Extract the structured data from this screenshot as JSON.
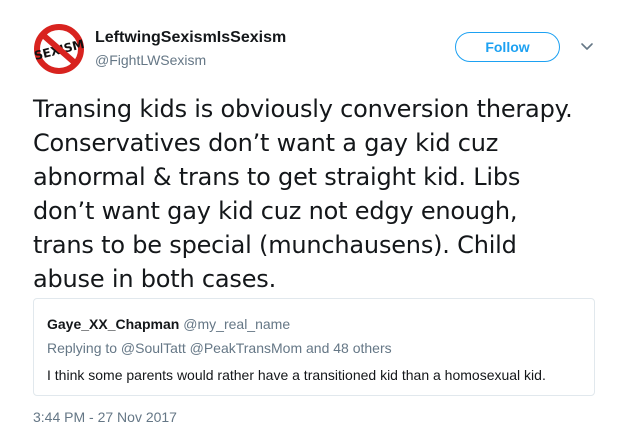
{
  "author": {
    "display_name": "LeftwingSexismIsSexism",
    "handle": "@FightLWSexism",
    "avatar_label": "SEXISM",
    "avatar_icon": "no-sexism-prohibition-icon"
  },
  "follow_button": {
    "label": "Follow"
  },
  "menu": {
    "icon": "chevron-down-icon"
  },
  "tweet": {
    "lines": [
      "Transing kids is obviously conversion therapy.",
      "Conservatives don’t want a gay kid cuz",
      "abnormal & trans to get straight kid. Libs",
      "don’t want gay kid cuz not edgy enough,",
      "trans to be special (munchausens). Child",
      "abuse in both cases."
    ],
    "timestamp": "3:44 PM - 27 Nov 2017"
  },
  "quoted_tweet": {
    "display_name": "Gaye_XX_Chapman",
    "handle": "@my_real_name",
    "replying_to": "Replying to @SoulTatt @PeakTransMom and 48 others",
    "text": "I think some parents would rather have a transitioned kid than a homosexual kid."
  },
  "colors": {
    "accent": "#1da1f2",
    "secondary_text": "#657786",
    "primary_text": "#14171a",
    "border": "#e1e8ed",
    "prohibition_red": "#d8231f"
  }
}
